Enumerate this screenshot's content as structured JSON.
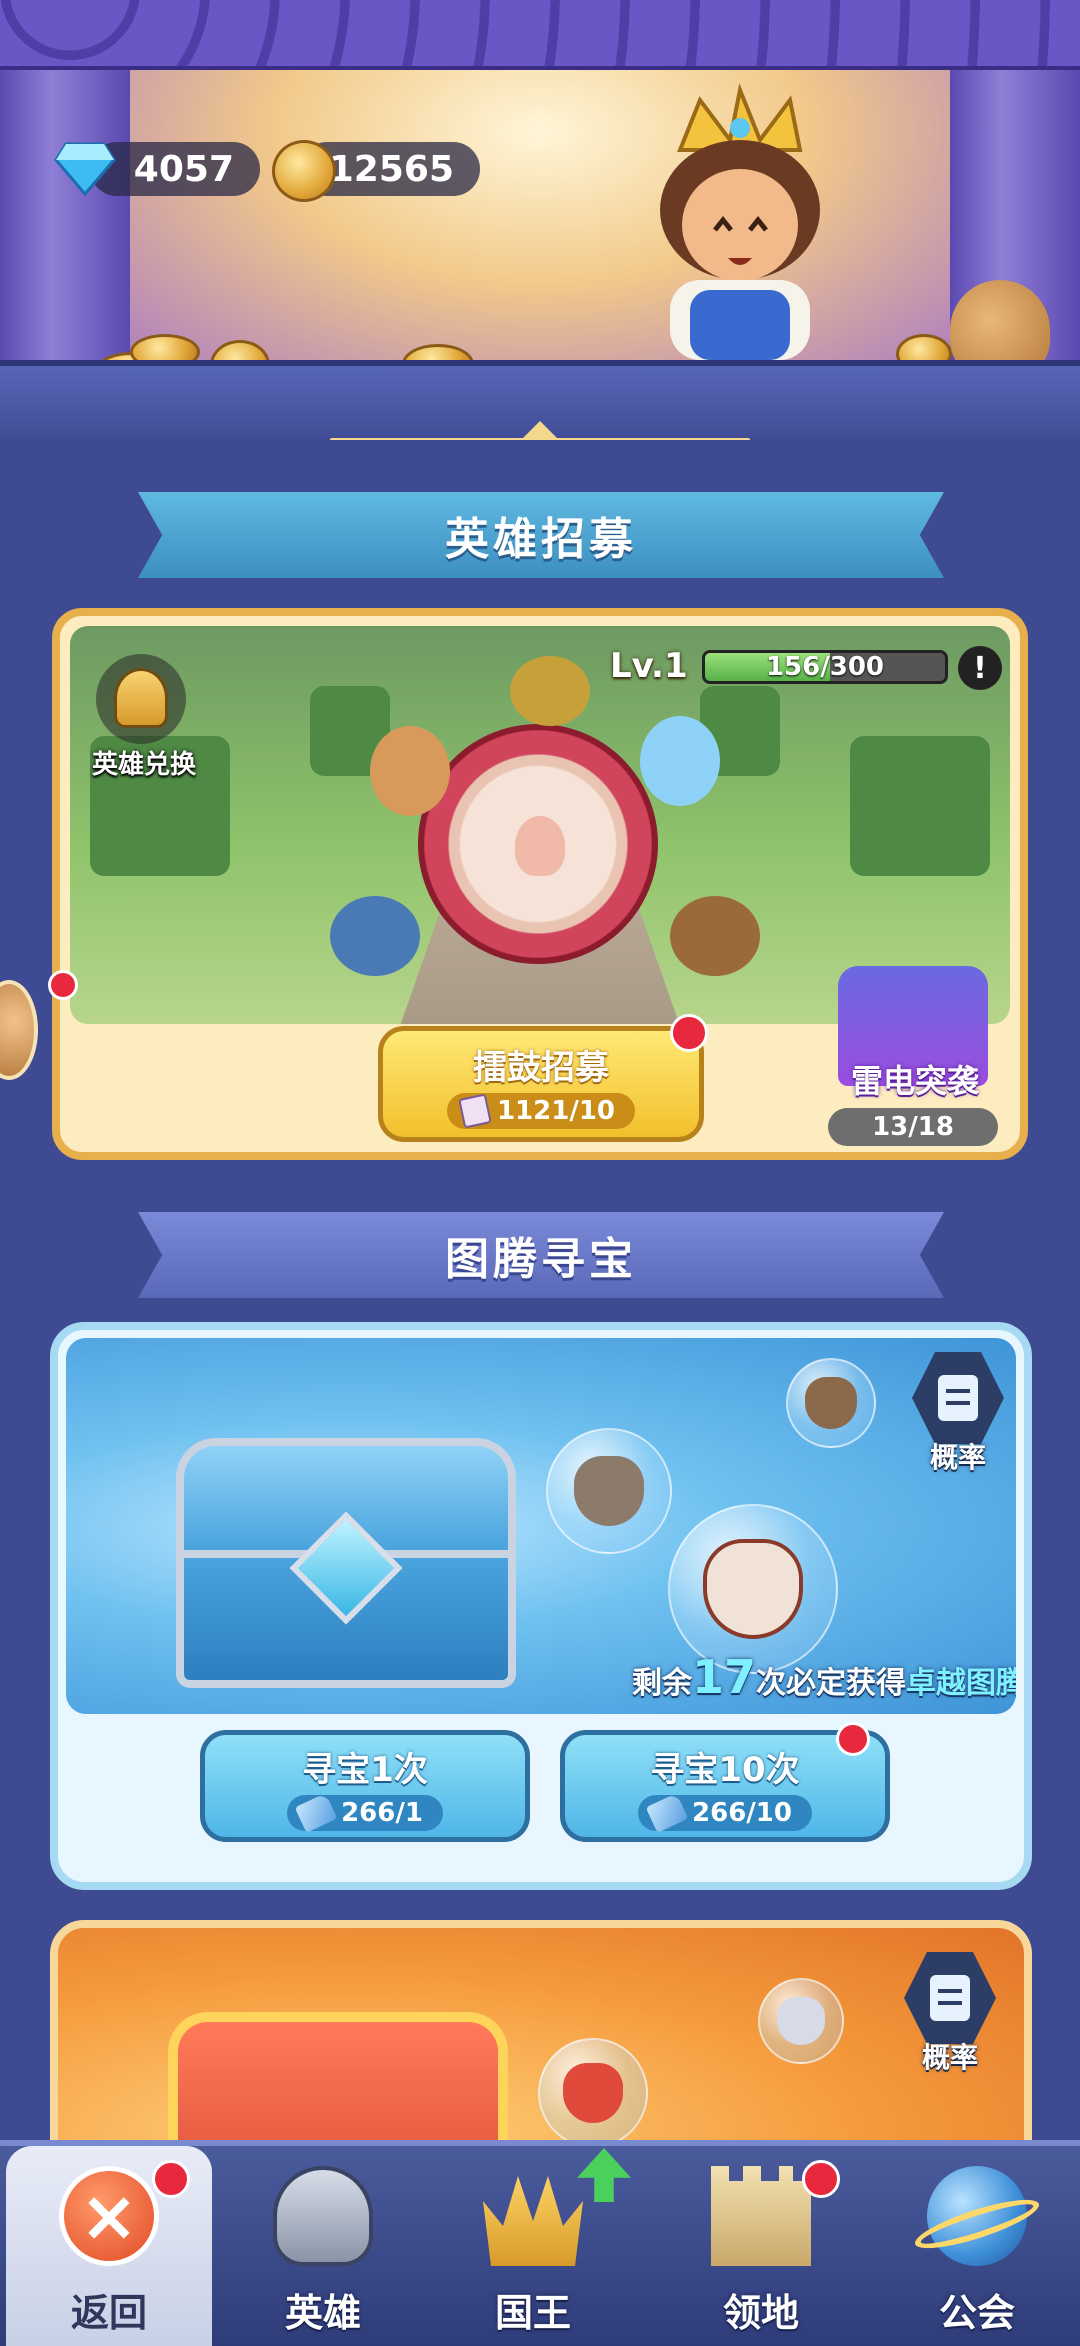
{
  "currency": {
    "gems": "4057",
    "gold": "12565"
  },
  "hero_recruit": {
    "section_title": "英雄招募",
    "exchange_label": "英雄兑换",
    "level": "Lv.1",
    "xp_text": "156/300",
    "xp_fraction": 0.52,
    "info_glyph": "!",
    "drum_button_title": "擂鼓招募",
    "drum_button_cost": "1121/10",
    "event_title": "雷电突袭",
    "event_progress": "13/18"
  },
  "totem_hunt": {
    "section_title": "图腾寻宝",
    "probability_label": "概率",
    "guarantee_prefix": "剩余",
    "guarantee_count": "17",
    "guarantee_mid": "次必定获得",
    "guarantee_item": "卓越图腾",
    "hunt_once_title": "寻宝1次",
    "hunt_once_cost": "266/1",
    "hunt_ten_title": "寻宝10次",
    "hunt_ten_cost": "266/10"
  },
  "gold_hunt": {
    "probability_label": "概率"
  },
  "bottom_nav": {
    "items": [
      {
        "label": "返回",
        "icon": "close-icon",
        "active": true
      },
      {
        "label": "英雄",
        "icon": "knight-helmet-icon"
      },
      {
        "label": "国王",
        "icon": "crown-icon"
      },
      {
        "label": "领地",
        "icon": "castle-icon"
      },
      {
        "label": "公会",
        "icon": "planet-icon"
      }
    ]
  },
  "colors": {
    "background": "#3e4a92",
    "ribbon_blue": "#5fb9e0",
    "recruit_border": "#e8b04c",
    "button_gold": "#f2c02c",
    "button_blue": "#4fb6e8",
    "xp_green": "#56b247",
    "notify_red": "#e8283c"
  }
}
